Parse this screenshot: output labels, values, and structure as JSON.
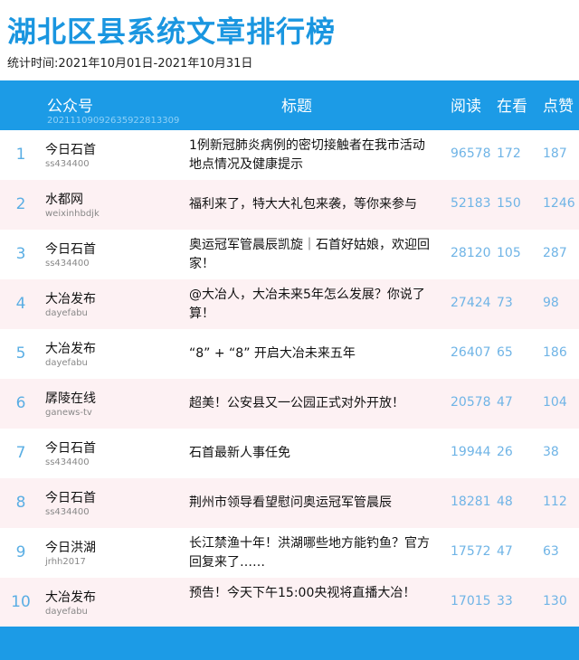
{
  "page": {
    "title": "湖北区县系统文章排行榜",
    "period": "统计时间:2021年10月01日-2021年10月31日"
  },
  "header": {
    "account_label": "公众号",
    "account_id": "20211109092635922813309",
    "title_label": "标题",
    "reads_label": "阅读",
    "watching_label": "在看",
    "likes_label": "点赞"
  },
  "rows": [
    {
      "rank": "1",
      "account": "今日石首",
      "account_id": "ss434400",
      "title": "1例新冠肺炎病例的密切接触者在我市活动地点情况及健康提示",
      "reads": "96578",
      "watching": "172",
      "likes": "187"
    },
    {
      "rank": "2",
      "account": "水都网",
      "account_id": "weixinhbdjk",
      "title": "福利来了，特大大礼包来袭，等你来参与",
      "reads": "52183",
      "watching": "150",
      "likes": "1246"
    },
    {
      "rank": "3",
      "account": "今日石首",
      "account_id": "ss434400",
      "title": "奥运冠军管晨辰凯旋｜石首好姑娘，欢迎回家！",
      "reads": "28120",
      "watching": "105",
      "likes": "287"
    },
    {
      "rank": "4",
      "account": "大冶发布",
      "account_id": "dayefabu",
      "title": "@大冶人，大冶未来5年怎么发展？你说了算！",
      "reads": "27424",
      "watching": "73",
      "likes": "98"
    },
    {
      "rank": "5",
      "account": "大冶发布",
      "account_id": "dayefabu",
      "title": "“8” + “8” 开启大冶未来五年",
      "reads": "26407",
      "watching": "65",
      "likes": "186"
    },
    {
      "rank": "6",
      "account": "孱陵在线",
      "account_id": "ganews-tv",
      "title": "超美！公安县又一公园正式对外开放！",
      "reads": "20578",
      "watching": "47",
      "likes": "104"
    },
    {
      "rank": "7",
      "account": "今日石首",
      "account_id": "ss434400",
      "title": "石首最新人事任免",
      "reads": "19944",
      "watching": "26",
      "likes": "38"
    },
    {
      "rank": "8",
      "account": "今日石首",
      "account_id": "ss434400",
      "title": "荆州市领导看望慰问奥运冠军管晨辰",
      "reads": "18281",
      "watching": "48",
      "likes": "112"
    },
    {
      "rank": "9",
      "account": "今日洪湖",
      "account_id": "jrhh2017",
      "title": "长江禁渔十年！洪湖哪些地方能钓鱼？官方回复来了……",
      "reads": "17572",
      "watching": "47",
      "likes": "63"
    },
    {
      "rank": "10",
      "account": "大冶发布",
      "account_id": "dayefabu",
      "title": "预告！今天下午15:00央视将直播大冶！",
      "reads": "17015",
      "watching": "33",
      "likes": "130"
    }
  ],
  "colors": {
    "accent": "#1c9be6",
    "title_blue": "#1a96e0",
    "even_row": "#fdf1f3",
    "number": "#6fb4e6"
  }
}
